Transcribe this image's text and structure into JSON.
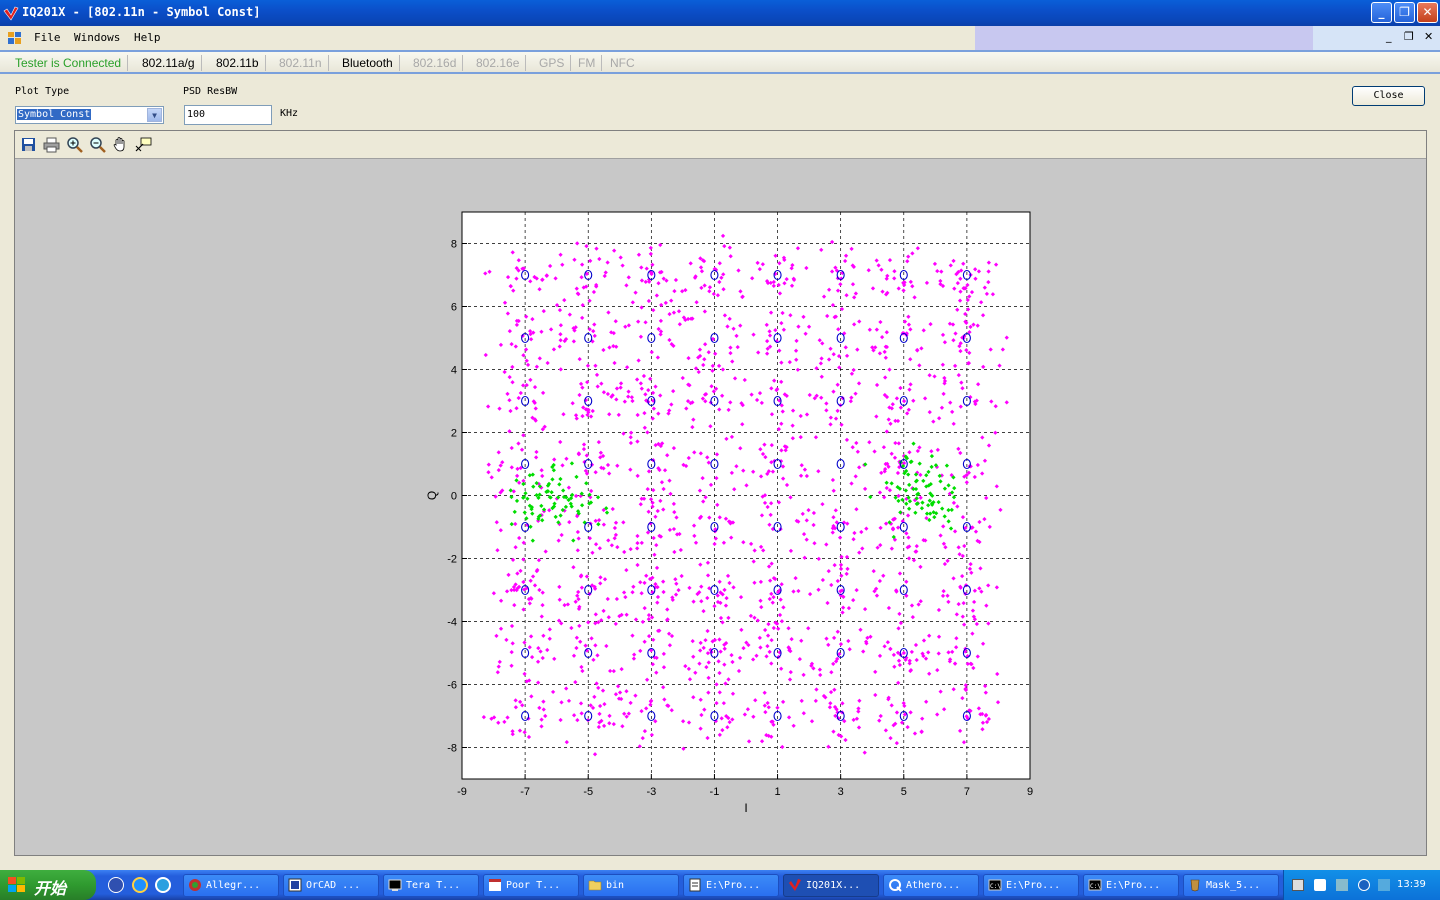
{
  "window": {
    "title": "IQ201X - [802.11n - Symbol Const]",
    "min": "_",
    "restore": "❐",
    "close": "✕"
  },
  "menu": {
    "file": "File",
    "windows": "Windows",
    "help": "Help",
    "mdi_min": "_",
    "mdi_restore": "❐",
    "mdi_close": "✕"
  },
  "tabs": {
    "status": "Tester is Connected",
    "items": [
      {
        "label": "802.11a/g",
        "enabled": true
      },
      {
        "label": "802.11b",
        "enabled": true
      },
      {
        "label": "802.11n",
        "enabled": false
      },
      {
        "label": "Bluetooth",
        "enabled": true
      },
      {
        "label": "802.16d",
        "enabled": false
      },
      {
        "label": "802.16e",
        "enabled": false
      },
      {
        "label": "GPS",
        "enabled": false
      },
      {
        "label": "FM",
        "enabled": false
      },
      {
        "label": "NFC",
        "enabled": false
      }
    ]
  },
  "controls": {
    "plot_type_label": "Plot Type",
    "plot_type_value": "Symbol Const",
    "psd_label": "PSD ResBW",
    "psd_value": "100",
    "psd_unit": "KHz",
    "close_button": "Close"
  },
  "toolbar_icons": [
    "save-icon",
    "print-icon",
    "zoom-in-icon",
    "zoom-out-icon",
    "pan-hand-icon",
    "data-cursor-icon"
  ],
  "chart_data": {
    "type": "scatter",
    "xlabel": "I",
    "ylabel": "Q",
    "xlim": [
      -9,
      9
    ],
    "ylim": [
      -9,
      9
    ],
    "xticks": [
      -9,
      -7,
      -5,
      -3,
      -1,
      1,
      3,
      5,
      7,
      9
    ],
    "yticks": [
      -8,
      -6,
      -4,
      -2,
      0,
      2,
      4,
      6,
      8
    ],
    "grid": true,
    "ideal_points": {
      "marker": "circle",
      "color": "#0000cc",
      "i_values": [
        -7,
        -5,
        -3,
        -1,
        1,
        3,
        5,
        7
      ],
      "q_values": [
        -7,
        -5,
        -3,
        -1,
        1,
        3,
        5,
        7
      ]
    },
    "measured_series": [
      {
        "color": "#ff00ff",
        "marker": "dot",
        "description_region": "full 64-QAM cloud, spread about ±0.9 around ideal points"
      },
      {
        "color": "#00dd00",
        "marker": "dot",
        "description_region": "pilot clusters near (-6,0) and (5.5,0)"
      }
    ]
  },
  "taskbar": {
    "start": "开始",
    "tasks": [
      {
        "label": "Allegr...",
        "active": false
      },
      {
        "label": "OrCAD ...",
        "active": false
      },
      {
        "label": "Tera T...",
        "active": false
      },
      {
        "label": "Poor T...",
        "active": false
      },
      {
        "label": "bin",
        "active": false
      },
      {
        "label": "E:\\Pro...",
        "active": false
      },
      {
        "label": "IQ201X...",
        "active": true
      },
      {
        "label": "Athero...",
        "active": false
      },
      {
        "label": "E:\\Pro...",
        "active": false
      },
      {
        "label": "E:\\Pro...",
        "active": false
      },
      {
        "label": "Mask_5...",
        "active": false
      }
    ],
    "clock": "13:39"
  }
}
